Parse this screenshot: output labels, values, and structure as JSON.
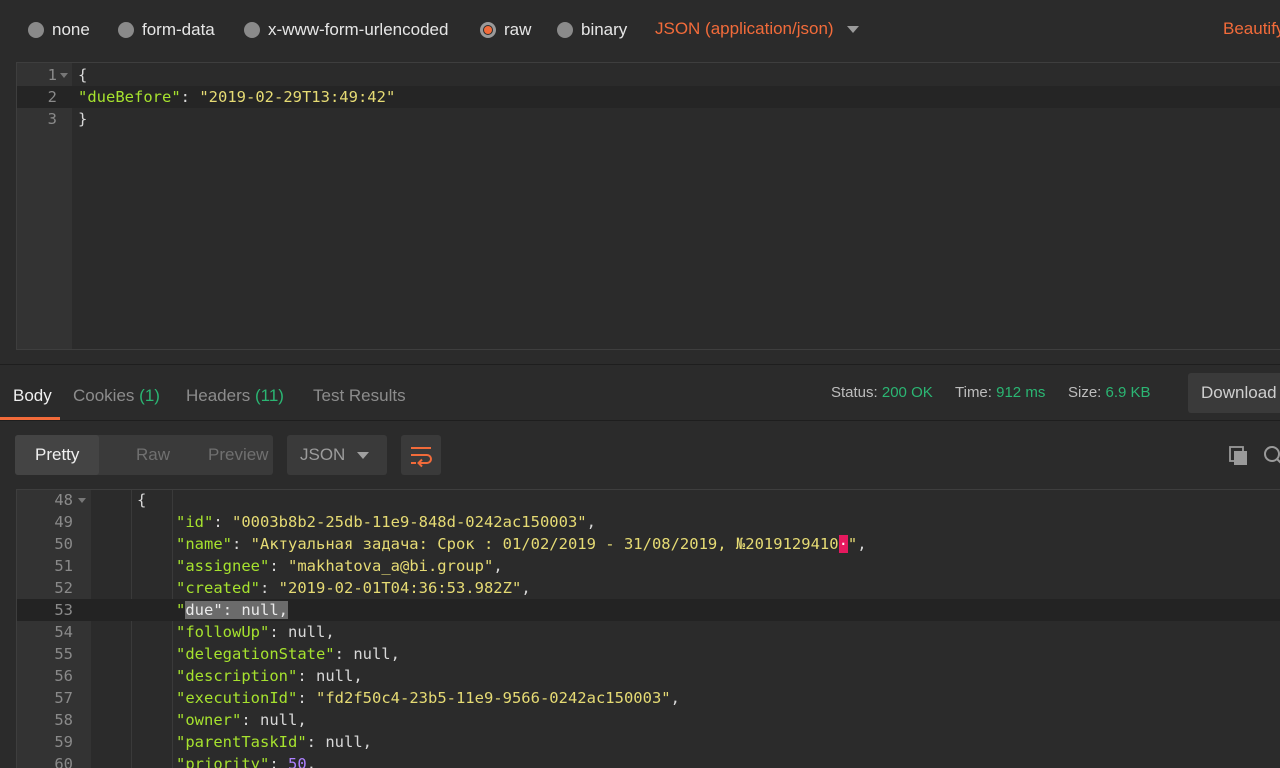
{
  "body_types": {
    "options": [
      "none",
      "form-data",
      "x-www-form-urlencoded",
      "raw",
      "binary"
    ],
    "selected": "raw",
    "content_type": "JSON (application/json)",
    "beautify_label": "Beautify"
  },
  "request": {
    "line_numbers": [
      "1",
      "2",
      "3"
    ],
    "lines": {
      "l1": "{",
      "l2_key": "\"dueBefore\"",
      "l2_sep": ": ",
      "l2_val": "\"2019-02-29T13:49:42\"",
      "l3": "}"
    }
  },
  "response_tabs": {
    "body": "Body",
    "cookies": "Cookies",
    "cookies_count": "(1)",
    "headers": "Headers",
    "headers_count": "(11)",
    "test_results": "Test Results"
  },
  "status": {
    "status_label": "Status:",
    "status_value": "200 OK",
    "time_label": "Time:",
    "time_value": "912 ms",
    "size_label": "Size:",
    "size_value": "6.9 KB",
    "download_label": "Download"
  },
  "view": {
    "pretty": "Pretty",
    "raw": "Raw",
    "preview": "Preview",
    "format": "JSON"
  },
  "response": {
    "line_numbers": [
      "48",
      "49",
      "50",
      "51",
      "52",
      "53",
      "54",
      "55",
      "56",
      "57",
      "58",
      "59",
      "60"
    ],
    "l48": "{",
    "id_key": "\"id\"",
    "id_val": "\"0003b8b2-25db-11e9-848d-0242ac150003\"",
    "name_key": "\"name\"",
    "name_val": "\"Актуальная задача: Срок : 01/02/2019 - 31/08/2019, №2019129410",
    "name_cursor": "·",
    "name_end": "\"",
    "assignee_key": "\"assignee\"",
    "assignee_val": "\"makhatova_a@bi.group\"",
    "created_key": "\"created\"",
    "created_val": "\"2019-02-01T04:36:53.982Z\"",
    "due_q1": "\"",
    "due_word": "due",
    "due_q2": "\"",
    "due_rest": ": null,",
    "followup_key": "\"followUp\"",
    "delegation_key": "\"delegationState\"",
    "description_key": "\"description\"",
    "execution_key": "\"executionId\"",
    "execution_val": "\"fd2f50c4-23b5-11e9-9566-0242ac150003\"",
    "owner_key": "\"owner\"",
    "parent_key": "\"parentTaskId\"",
    "priority_key": "\"priority\"",
    "priority_val": "50",
    "null_value": "null",
    "sep": ": ",
    "comma": ","
  },
  "colors": {
    "accent": "#f26b3a",
    "success": "#2bb673",
    "json_key": "#a6e22e",
    "json_string": "#e6db74",
    "json_number": "#ae81ff",
    "cursor": "#e5195e"
  }
}
